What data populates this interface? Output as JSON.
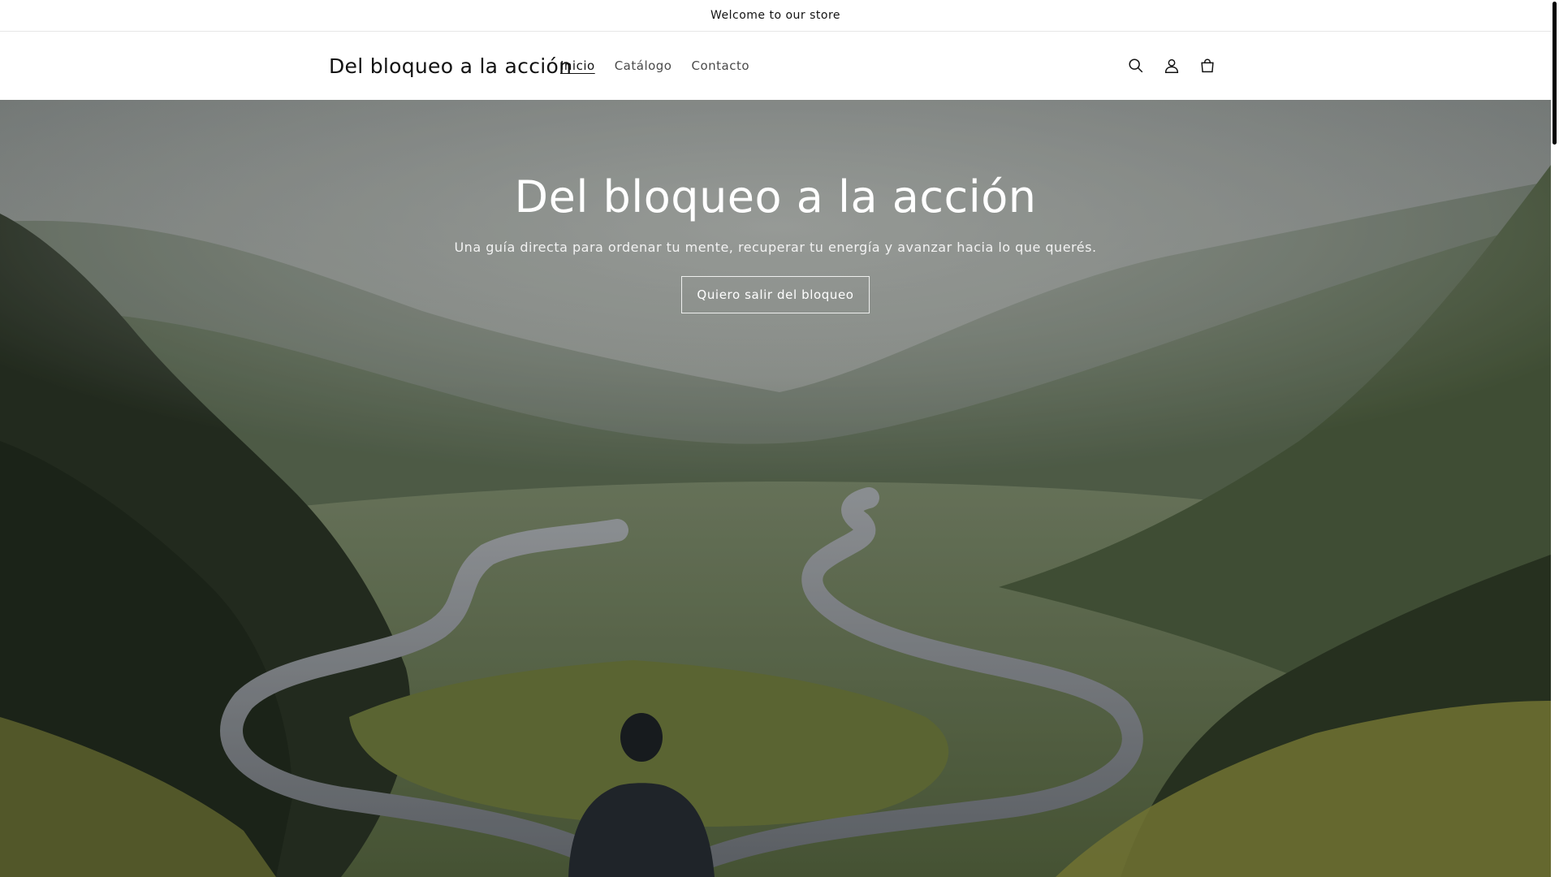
{
  "announcement": {
    "text": "Welcome to our store"
  },
  "header": {
    "logo": "Del bloqueo a la acción",
    "nav": [
      {
        "label": "Inicio",
        "active": true
      },
      {
        "label": "Catálogo",
        "active": false
      },
      {
        "label": "Contacto",
        "active": false
      }
    ],
    "icons": [
      "search-icon",
      "account-icon",
      "cart-icon"
    ]
  },
  "hero": {
    "title": "Del bloqueo a la acción",
    "subtitle": "Una guía directa para ordenar tu mente, recuperar tu energía y avanzar hacia lo que querés.",
    "button_label": "Quiero salir del bloqueo",
    "image_subject": "Person facing a road that splits into two winding paths through misty green valley"
  },
  "colors": {
    "text": "#121212",
    "border": "#e6e6e6",
    "hero_text": "#ffffff"
  }
}
